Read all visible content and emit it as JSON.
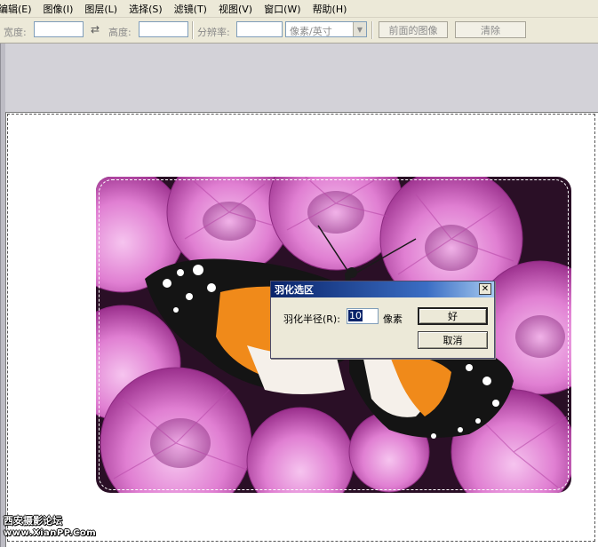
{
  "menubar": {
    "items": [
      {
        "label": "编辑(E)"
      },
      {
        "label": "图像(I)"
      },
      {
        "label": "图层(L)"
      },
      {
        "label": "选择(S)"
      },
      {
        "label": "滤镜(T)"
      },
      {
        "label": "视图(V)"
      },
      {
        "label": "窗口(W)"
      },
      {
        "label": "帮助(H)"
      }
    ]
  },
  "options": {
    "width_label": "宽度:",
    "width_value": "",
    "height_label": "高度:",
    "height_value": "",
    "resolution_label": "分辨率:",
    "resolution_value": "",
    "unit_select": "像素/英寸",
    "front_image_button": "前面的图像",
    "clear_button": "清除"
  },
  "dialog": {
    "title": "羽化选区",
    "radius_label": "羽化半径(R):",
    "radius_value": "10",
    "unit": "像素",
    "ok_button": "好",
    "cancel_button": "取消",
    "close_glyph": "✕"
  },
  "watermark": {
    "line1": "西安摄影论坛",
    "line2": "www.XianPP.Com"
  },
  "colors": {
    "ui_face": "#ece9d8",
    "title_bar": "#0a246a",
    "petal_pink": "#e07fd2",
    "butterfly_orange": "#f08a1a"
  }
}
